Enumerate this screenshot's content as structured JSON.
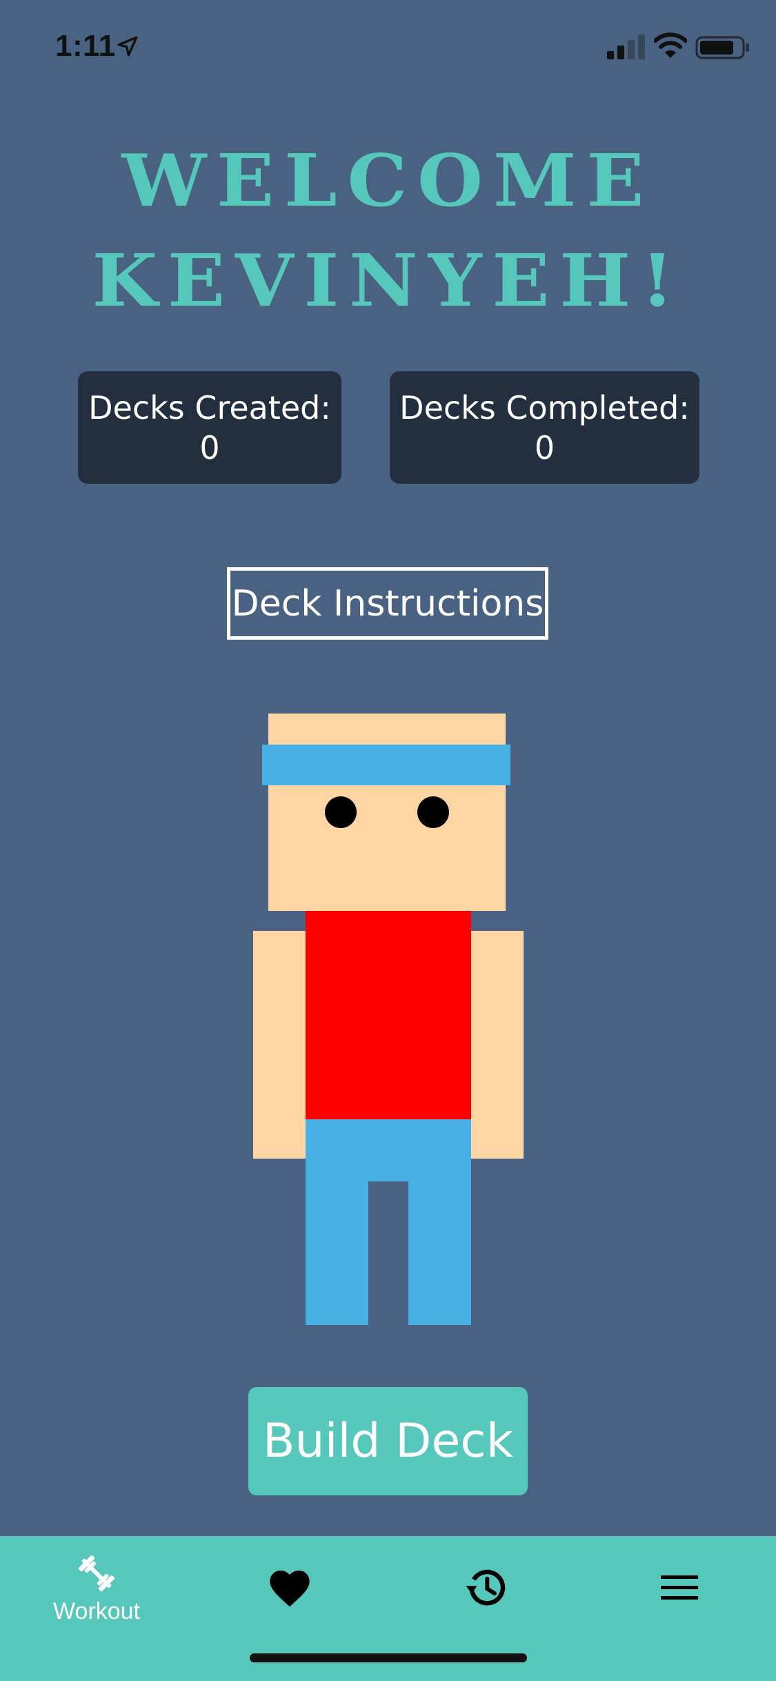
{
  "status_bar": {
    "time": "1:11",
    "icons": [
      "location-arrow-icon",
      "signal-icon",
      "wifi-icon",
      "battery-icon"
    ]
  },
  "header": {
    "title_line1": "WELCOME",
    "title_line2": "KEVINYEH!"
  },
  "stats": {
    "created_label": "Decks Created:",
    "created_value": "0",
    "completed_label": "Decks Completed:",
    "completed_value": "0"
  },
  "actions": {
    "instructions_label": "Deck Instructions",
    "build_label": "Build Deck"
  },
  "tabbar": {
    "items": [
      {
        "label": "Workout",
        "icon": "dumbbell-icon",
        "active": true
      },
      {
        "label": "",
        "icon": "heart-icon"
      },
      {
        "label": "",
        "icon": "history-icon"
      },
      {
        "label": "",
        "icon": "menu-icon"
      }
    ]
  },
  "colors": {
    "background": "#4a6282",
    "accent": "#56c8bb",
    "card": "#232e3f",
    "shirt": "#ff0000",
    "skin": "#ffd5a3",
    "pants": "#49b0e5"
  }
}
